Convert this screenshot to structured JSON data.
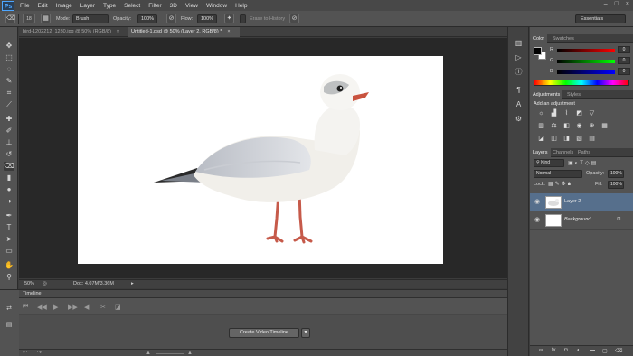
{
  "app": {
    "logo": "Ps"
  },
  "menu": [
    "File",
    "Edit",
    "Image",
    "Layer",
    "Type",
    "Select",
    "Filter",
    "3D",
    "View",
    "Window",
    "Help"
  ],
  "window_controls": [
    "–",
    "□",
    "×"
  ],
  "options": {
    "brush_size": "18",
    "mode_label": "Mode:",
    "mode_value": "Brush",
    "opacity_label": "Opacity:",
    "opacity_value": "100%",
    "flow_label": "Flow:",
    "flow_value": "100%",
    "erase_history": "Erase to History",
    "workspace": "Essentials"
  },
  "tabs": [
    {
      "label": "bird-1202212_1280.jpg @ 50% (RGB/8)",
      "close": "×"
    },
    {
      "label": "Untitled-1.psd @ 50% (Layer 2, RGB/8) *",
      "close": "×"
    }
  ],
  "status": {
    "zoom": "50%",
    "doc": "Doc: 4.07M/3.36M"
  },
  "timeline": {
    "title": "Timeline",
    "create_button": "Create Video Timeline"
  },
  "color_panel": {
    "tabs": [
      "Color",
      "Swatches"
    ],
    "channels": [
      {
        "label": "R",
        "value": "0"
      },
      {
        "label": "G",
        "value": "0"
      },
      {
        "label": "B",
        "value": "0"
      }
    ]
  },
  "adjustments_panel": {
    "tabs": [
      "Adjustments",
      "Styles"
    ],
    "heading": "Add an adjustment"
  },
  "layers_panel": {
    "tabs": [
      "Layers",
      "Channels",
      "Paths"
    ],
    "filter_kind": "Kind",
    "blend_mode": "Normal",
    "opacity_label": "Opacity:",
    "opacity_value": "100%",
    "lock_label": "Lock:",
    "fill_label": "Fill:",
    "fill_value": "100%",
    "layers": [
      {
        "name": "Layer 2",
        "selected": true
      },
      {
        "name": "Background",
        "selected": false,
        "locked": true
      }
    ],
    "footer_icons": [
      "link-icon",
      "fx-icon",
      "mask-icon",
      "adjustment-icon",
      "folder-icon",
      "new-layer-icon",
      "trash-icon"
    ]
  },
  "colors": {
    "accent": "#4da6ff",
    "selected_layer": "#566f8c"
  }
}
